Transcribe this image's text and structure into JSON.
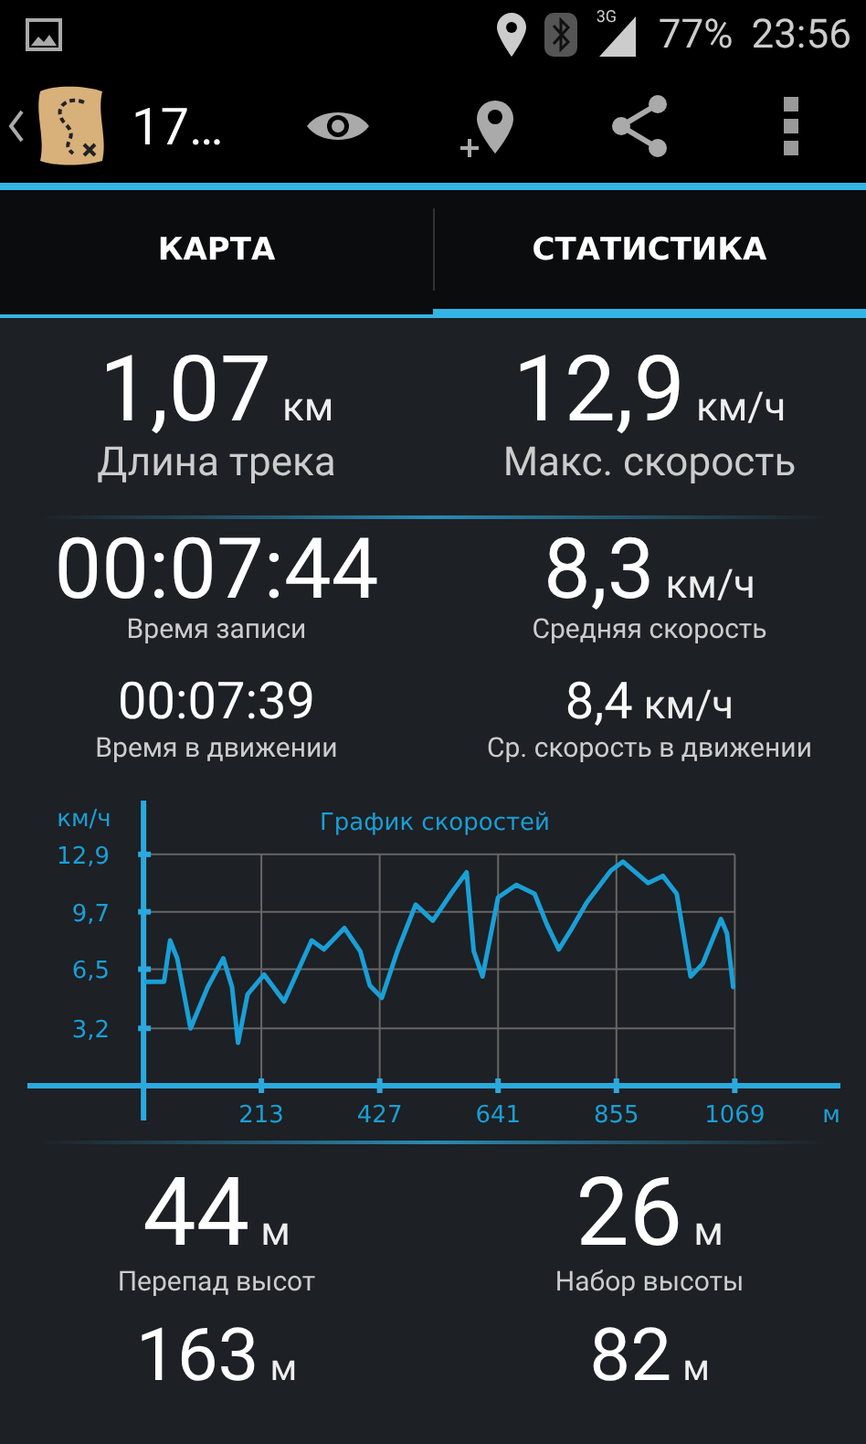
{
  "status_bar": {
    "network": "3G",
    "battery": "77%",
    "time": "23:56"
  },
  "action_bar": {
    "title": "17…"
  },
  "tabs": [
    {
      "label": "КАРТА",
      "selected": false
    },
    {
      "label": "СТАТИСТИКА",
      "selected": true
    }
  ],
  "stat_rows": [
    {
      "items": [
        {
          "value": "1,07",
          "unit": "км",
          "label": "Длина трека"
        },
        {
          "value": "12,9",
          "unit": "км/ч",
          "label": "Макс. скорость"
        }
      ]
    },
    {
      "items": [
        {
          "value": "00:07:44",
          "label": "Время записи"
        },
        {
          "value": "8,3",
          "unit": "км/ч",
          "label": "Средняя скорость"
        }
      ]
    },
    {
      "items": [
        {
          "value": "00:07:39",
          "label": "Время в движении"
        },
        {
          "value": "8,4",
          "unit": "км/ч",
          "label": "Ср. скорость в движении"
        }
      ]
    }
  ],
  "chart": {
    "chart_data": {
      "type": "line",
      "title": "График скоростей",
      "xlabel": "м",
      "ylabel": "км/ч",
      "grid": true,
      "xlim": [
        -210,
        1260
      ],
      "ylim": [
        0,
        15.9
      ],
      "xticks": [
        213,
        427,
        641,
        855,
        1069
      ],
      "yticks": [
        {
          "value": 3.2,
          "label": "3,2"
        },
        {
          "value": 6.5,
          "label": "6,5"
        },
        {
          "value": 9.7,
          "label": "9,7"
        },
        {
          "value": 12.9,
          "label": "12,9"
        }
      ],
      "x": [
        5,
        37,
        48,
        61,
        85,
        116,
        144,
        160,
        171,
        188,
        218,
        254,
        304,
        326,
        363,
        392,
        409,
        431,
        459,
        492,
        523,
        558,
        584,
        597,
        613,
        641,
        674,
        707,
        729,
        751,
        773,
        801,
        845,
        867,
        912,
        939,
        964,
        989,
        1011,
        1044,
        1055,
        1066
      ],
      "series": [
        {
          "color": "#1a9fd6",
          "values": [
            5.8,
            5.8,
            8.1,
            7.1,
            3.2,
            5.5,
            7.1,
            5.5,
            2.4,
            5.1,
            6.2,
            4.7,
            8.1,
            7.6,
            8.8,
            7.5,
            5.6,
            4.9,
            7.5,
            10.1,
            9.2,
            10.8,
            11.9,
            7.5,
            6.1,
            10.5,
            11.2,
            10.7,
            9.0,
            7.6,
            8.7,
            10.2,
            12.0,
            12.5,
            11.3,
            11.7,
            10.7,
            6.1,
            6.8,
            9.3,
            8.5,
            5.5
          ]
        }
      ]
    }
  },
  "stat_rows_bottom": [
    {
      "items": [
        {
          "value": "44",
          "unit": "м",
          "label": "Перепад высот"
        },
        {
          "value": "26",
          "unit": "м",
          "label": "Набор высоты"
        }
      ]
    },
    {
      "items": [
        {
          "value": "163",
          "unit": "м"
        },
        {
          "value": "82",
          "unit": "м"
        }
      ]
    }
  ]
}
